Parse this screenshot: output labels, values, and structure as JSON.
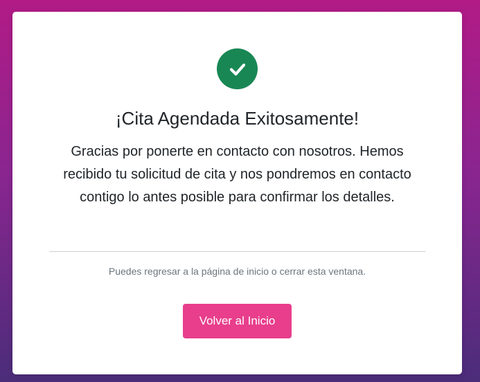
{
  "confirmation": {
    "icon": "check-circle-icon",
    "icon_color": "#198754",
    "title": "¡Cita Agendada Exitosamente!",
    "message": "Gracias por ponerte en contacto con nosotros. Hemos recibido tu solicitud de cita y nos pondremos en contacto contigo lo antes posible para confirmar los detalles.",
    "note": "Puedes regresar a la página de inicio o cerrar esta ventana.",
    "button_label": "Volver al Inicio",
    "button_color": "#e83e8c"
  }
}
